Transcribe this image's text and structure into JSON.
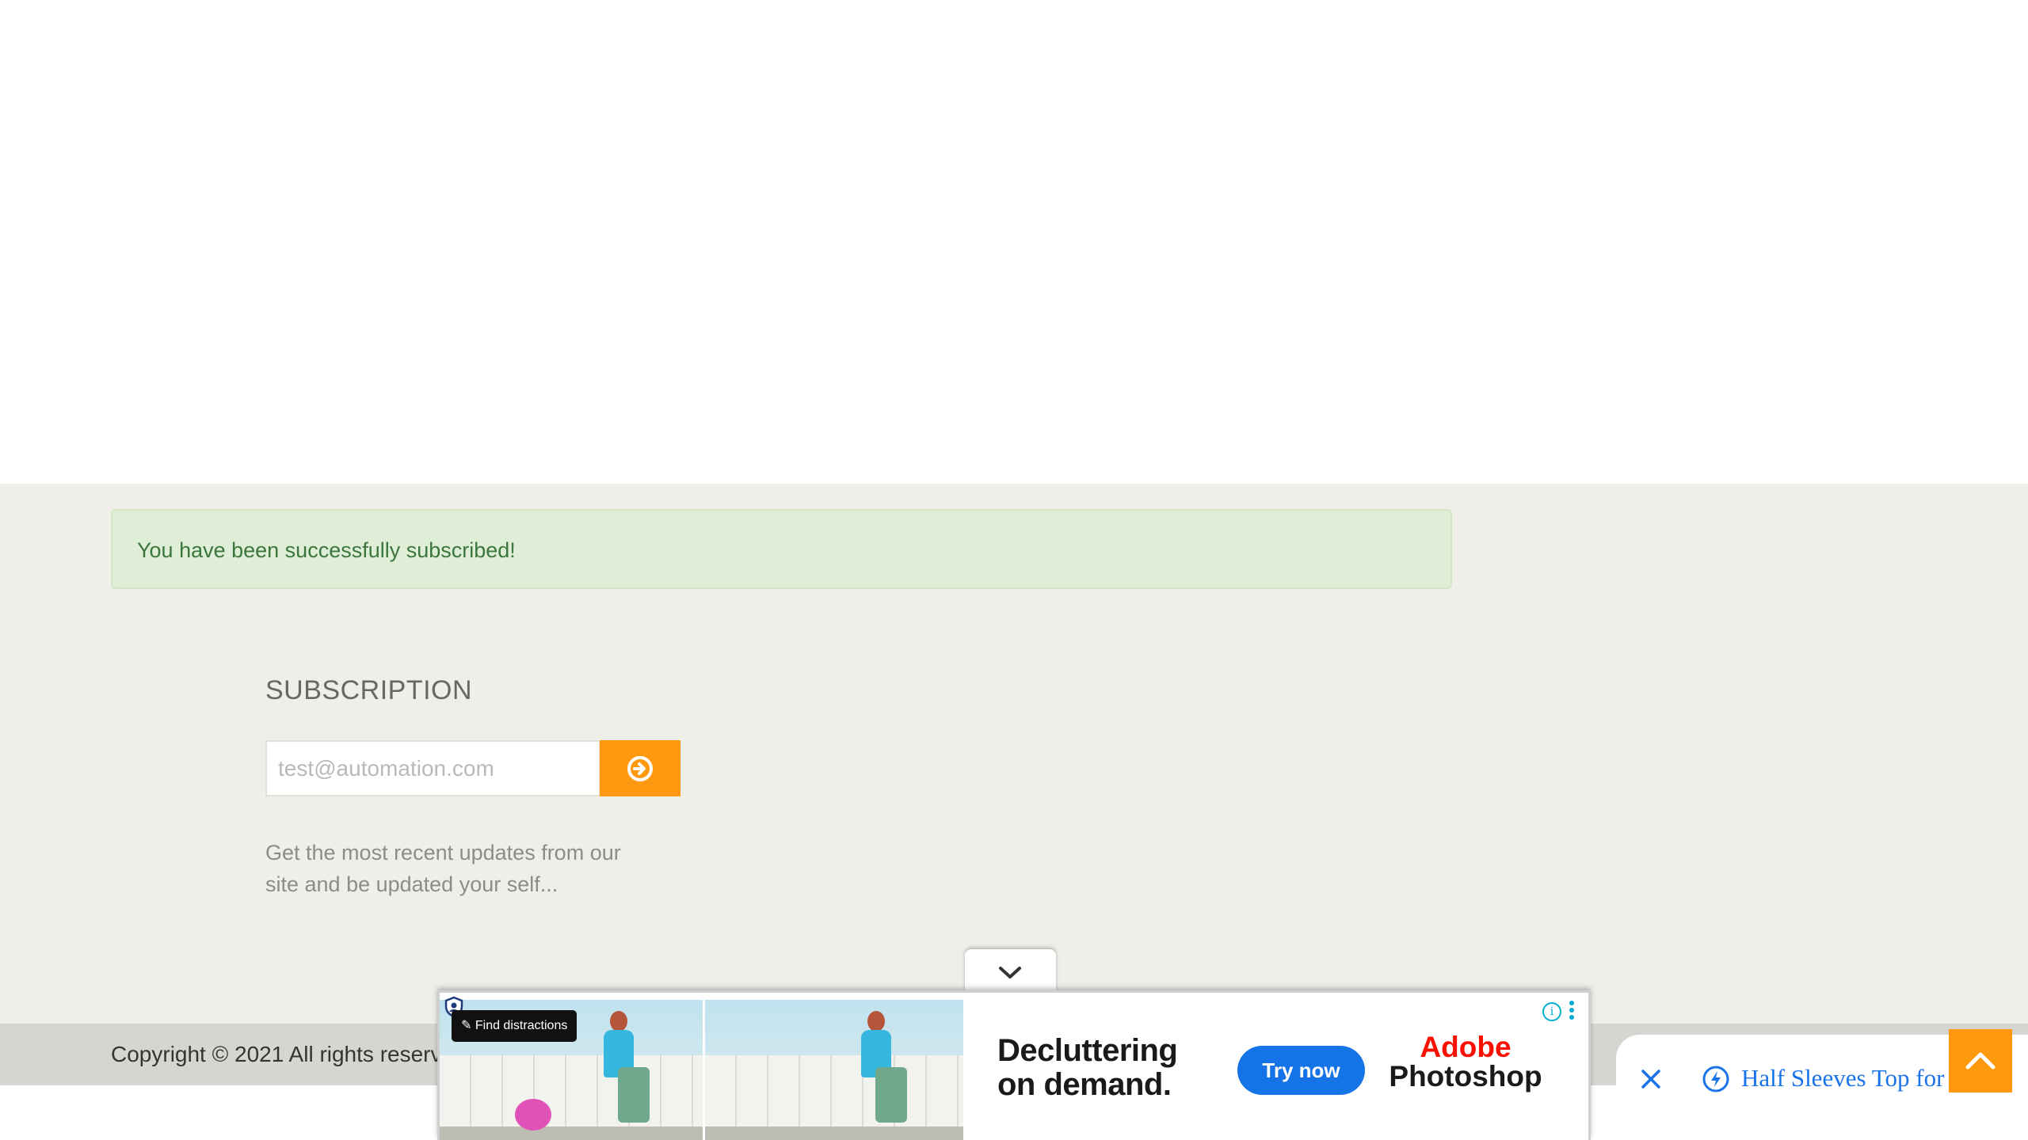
{
  "alert": {
    "message": "You have been successfully subscribed!"
  },
  "subscription": {
    "title": "SUBSCRIPTION",
    "email_placeholder": "test@automation.com",
    "button_icon": "arrow-circle-right-icon",
    "description": "Get the most recent updates from our site and be updated your self..."
  },
  "footer": {
    "copyright": "Copyright © 2021 All rights reserv"
  },
  "ad": {
    "toggle_icon": "chevron-down-icon",
    "find_distractions": "Find distractions",
    "headline_line1": "Decluttering",
    "headline_line2": "on demand.",
    "cta": "Try now",
    "brand_line1": "Adobe",
    "brand_line2": "Photoshop"
  },
  "side_notice": {
    "text": "Half Sleeves Top for",
    "close_icon": "close-icon",
    "bolt_icon": "bolt-icon"
  },
  "scroll_up_icon": "chevron-up-icon",
  "colors": {
    "accent": "#fe980f",
    "alert_bg": "#dfeed7",
    "alert_text": "#3c763d",
    "footer_bg": "#efeee8",
    "cta_blue": "#1473e6",
    "adobe_red": "#fa0f00"
  }
}
